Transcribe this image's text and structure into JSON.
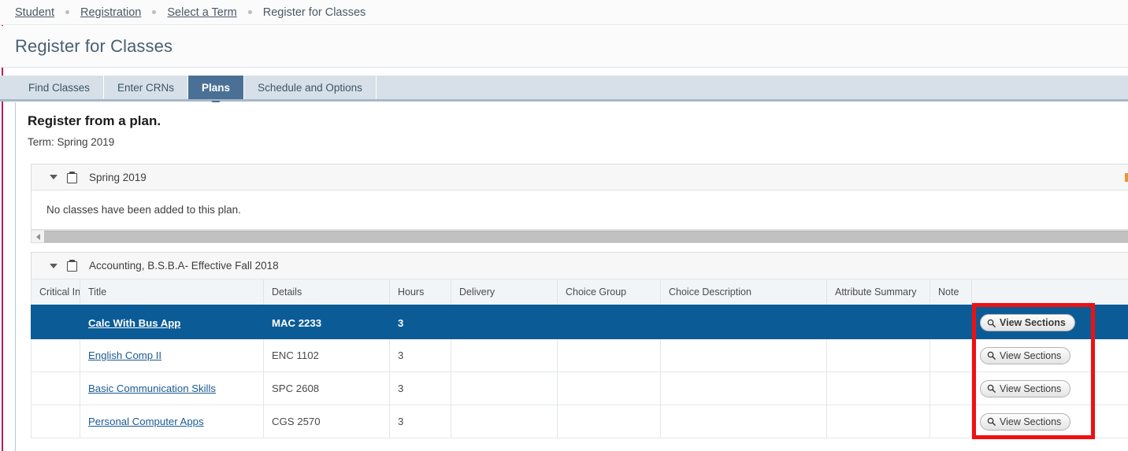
{
  "breadcrumb": {
    "items": [
      {
        "label": "Student",
        "link": true
      },
      {
        "label": "Registration",
        "link": true
      },
      {
        "label": "Select a Term",
        "link": true
      },
      {
        "label": "Register for Classes",
        "link": false
      }
    ]
  },
  "header": {
    "title": "Register for Classes"
  },
  "tabs": [
    {
      "label": "Find Classes",
      "active": false
    },
    {
      "label": "Enter CRNs",
      "active": false
    },
    {
      "label": "Plans",
      "active": true
    },
    {
      "label": "Schedule and Options",
      "active": false
    }
  ],
  "main": {
    "heading": "Register from a plan.",
    "term_line": "Term: Spring 2019",
    "plan_empty": {
      "title": "Spring 2019",
      "message": "No classes have been added to this plan."
    },
    "plan_table": {
      "title": "Accounting, B.S.B.A- Effective Fall 2018",
      "columns": [
        "Critical In",
        "Title",
        "Details",
        "Hours",
        "Delivery",
        "Choice Group",
        "Choice Description",
        "Attribute Summary",
        "Note",
        ""
      ],
      "rows": [
        {
          "critical": "",
          "title": "Calc With Bus App",
          "details": "MAC 2233",
          "hours": "3",
          "delivery": "",
          "choice_group": "",
          "choice_description": "",
          "attribute_summary": "",
          "note": "",
          "action": "View Sections",
          "selected": true
        },
        {
          "critical": "",
          "title": "English Comp II",
          "details": "ENC 1102",
          "hours": "3",
          "delivery": "",
          "choice_group": "",
          "choice_description": "",
          "attribute_summary": "",
          "note": "",
          "action": "View Sections",
          "selected": false
        },
        {
          "critical": "",
          "title": "Basic Communication Skills",
          "details": "SPC 2608",
          "hours": "3",
          "delivery": "",
          "choice_group": "",
          "choice_description": "",
          "attribute_summary": "",
          "note": "",
          "action": "View Sections",
          "selected": false
        },
        {
          "critical": "",
          "title": "Personal Computer Apps",
          "details": "CGS 2570",
          "hours": "3",
          "delivery": "",
          "choice_group": "",
          "choice_description": "",
          "attribute_summary": "",
          "note": "",
          "action": "View Sections",
          "selected": false
        }
      ]
    }
  },
  "colors": {
    "accent_rail": "#c2185b",
    "tab_active": "#4a7096",
    "tabstrip_bg": "#d7e0e8",
    "row_selected": "#0b5c96",
    "annotation": "#ee1111",
    "link": "#1b5a94",
    "orange_marker": "#e8962f"
  }
}
